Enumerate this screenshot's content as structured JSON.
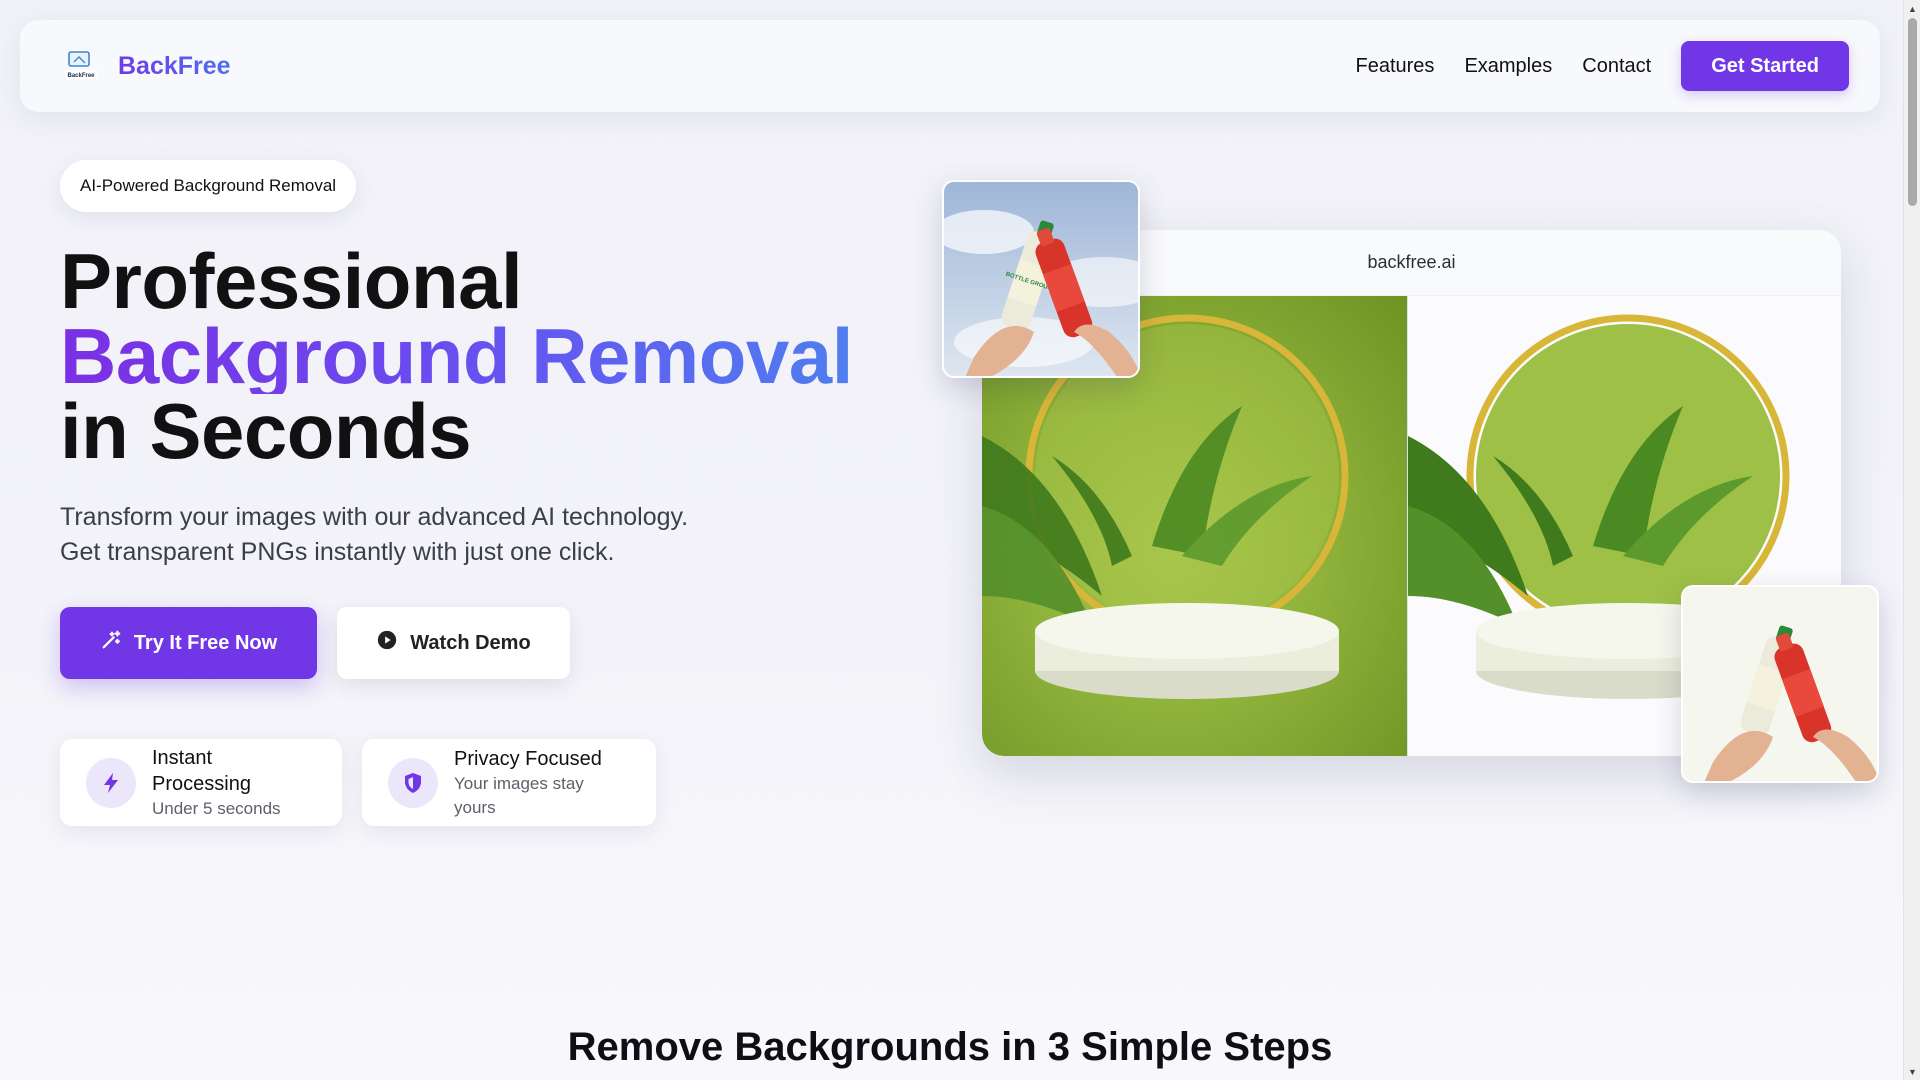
{
  "brand": {
    "name": "BackFree",
    "logo_icon": "backfree-logo-icon",
    "logo_text": "BackFree",
    "colors": {
      "primary": "#7136e6",
      "gradient_start": "#7b2fe3",
      "gradient_end": "#4f7ef0"
    }
  },
  "nav": {
    "links": [
      "Features",
      "Examples",
      "Contact"
    ],
    "cta": "Get Started"
  },
  "hero": {
    "badge": "AI-Powered Background Removal",
    "title_line1": "Professional",
    "title_line2": "Background Removal",
    "title_line3": "in Seconds",
    "subtitle_line1": "Transform your images with our advanced AI technology.",
    "subtitle_line2": "Get transparent PNGs instantly with just one click.",
    "primary_button": {
      "label": "Try It Free Now",
      "icon": "magic-wand-icon"
    },
    "secondary_button": {
      "label": "Watch Demo",
      "icon": "play-circle-icon"
    },
    "features": [
      {
        "title": "Instant Processing",
        "desc": "Under 5 seconds",
        "icon": "lightning-icon"
      },
      {
        "title": "Privacy Focused",
        "desc": "Your images stay yours",
        "icon": "shield-icon"
      }
    ]
  },
  "preview": {
    "url": "backfree.ai",
    "before_label": "",
    "after_label": "",
    "bottle_label_text": "BOTTLE GROUP"
  },
  "steps": {
    "title": "Remove Backgrounds in 3 Simple Steps"
  }
}
